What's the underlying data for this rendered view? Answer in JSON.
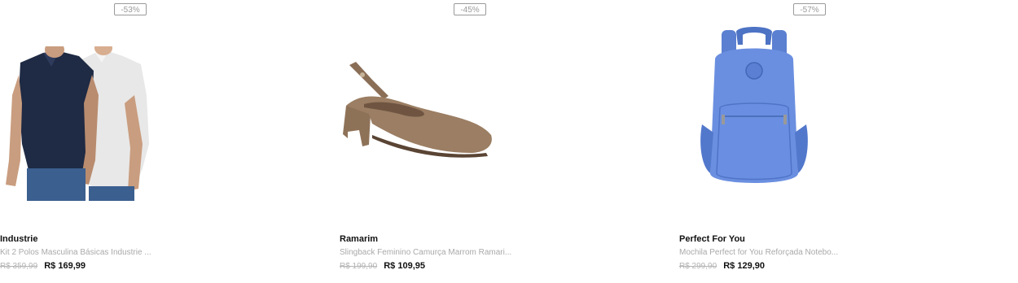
{
  "products": [
    {
      "discount": "-53%",
      "brand": "Industrie",
      "description": "Kit 2 Polos Masculina Básicas Industrie ...",
      "old_price": "R$ 359,99",
      "new_price": "R$ 169,99",
      "image_icon": "polo-shirts-image"
    },
    {
      "discount": "-45%",
      "brand": "Ramarim",
      "description": "Slingback Feminino Camurça Marrom Ramari...",
      "old_price": "R$ 199,90",
      "new_price": "R$ 109,95",
      "image_icon": "slingback-shoe-image"
    },
    {
      "discount": "-57%",
      "brand": "Perfect For You",
      "description": "Mochila Perfect for You Reforçada Notebo...",
      "old_price": "R$ 299,90",
      "new_price": "R$ 129,90",
      "image_icon": "backpack-image"
    }
  ]
}
